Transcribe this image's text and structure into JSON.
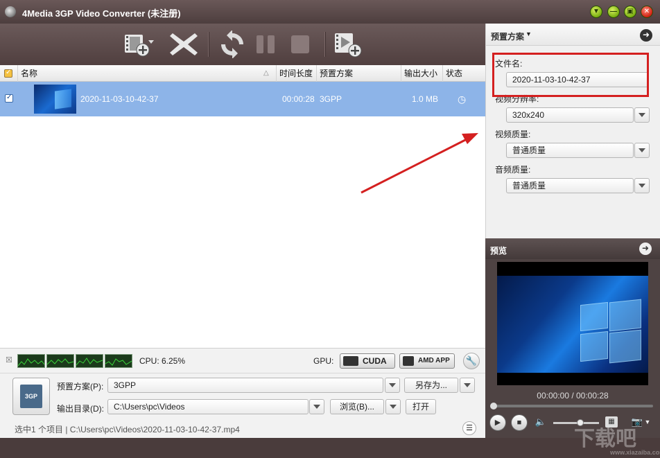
{
  "window": {
    "title": "4Media 3GP Video Converter (未注册)"
  },
  "file_list": {
    "columns": {
      "name": "名称",
      "duration": "时间长度",
      "profile": "预置方案",
      "size": "输出大小",
      "status": "状态"
    },
    "rows": [
      {
        "name": "2020-11-03-10-42-37",
        "duration": "00:00:28",
        "profile": "3GPP",
        "size": "1.0 MB",
        "status_icon": "clock-icon",
        "checked": true
      }
    ]
  },
  "cpu": {
    "label": "CPU: 6.25%"
  },
  "gpu": {
    "label": "GPU:",
    "cuda": "CUDA",
    "amd": "AMD APP"
  },
  "options": {
    "profile_label": "预置方案(P):",
    "profile_value": "3GPP",
    "save_as": "另存为...",
    "output_label": "输出目录(D):",
    "output_value": "C:\\Users\\pc\\Videos",
    "browse": "浏览(B)...",
    "open": "打开",
    "file_icon_text": "3GP"
  },
  "status_text": "选中1 个项目 | C:\\Users\\pc\\Videos\\2020-11-03-10-42-37.mp4",
  "preset_panel": {
    "title": "预置方案",
    "filename_label": "文件名:",
    "filename_value": "2020-11-03-10-42-37",
    "resolution_label": "视频分辨率:",
    "resolution_value": "320x240",
    "video_quality_label": "视频质量:",
    "video_quality_value": "普通质量",
    "audio_quality_label": "音频质量:",
    "audio_quality_value": "普通质量"
  },
  "preview": {
    "title": "预览",
    "timecode": "00:00:00 / 00:00:28",
    "seek_position": 0.0,
    "volume_level": 0.65
  },
  "watermark": {
    "main": "下载吧",
    "sub": "www.xiazaiba.com"
  },
  "colors": {
    "selected_row": "#8db4e8",
    "highlight_box": "#d42020",
    "arrow": "#d42020"
  }
}
